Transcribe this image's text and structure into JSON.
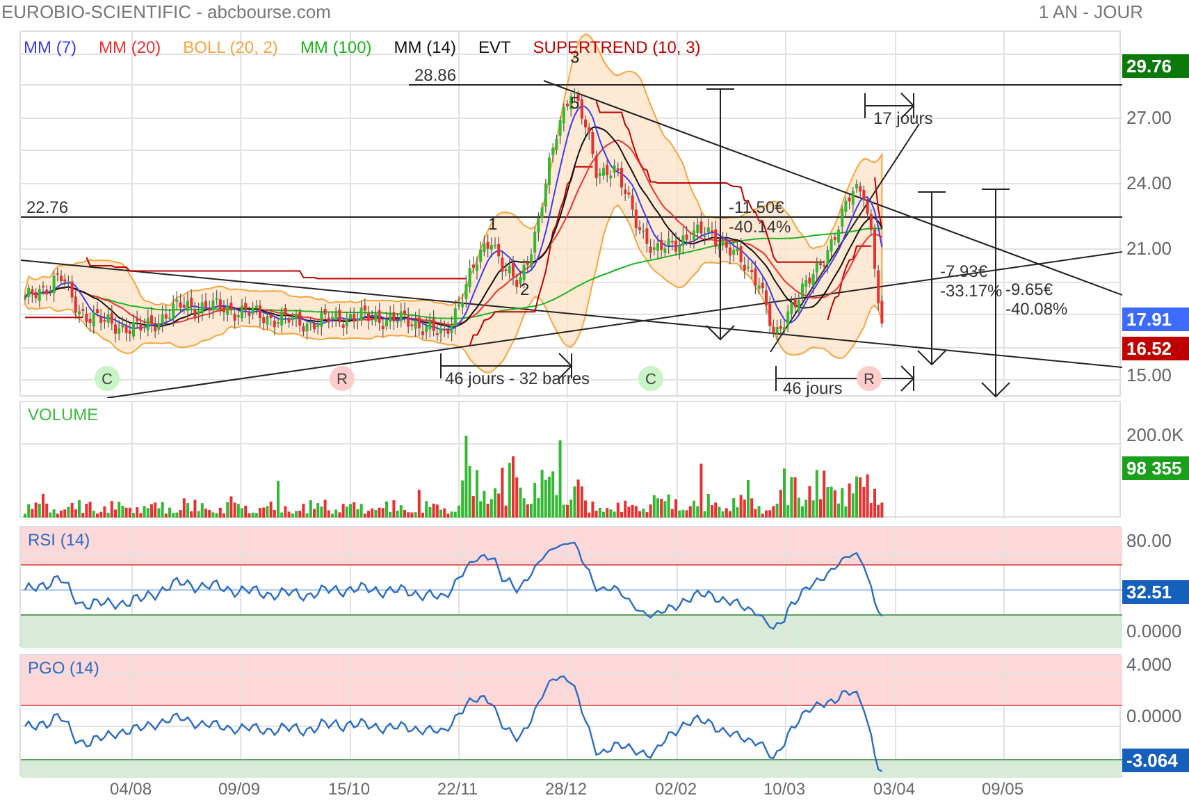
{
  "header": {
    "title": "EUROBIO-SCIENTIFIC - abcbourse.com",
    "period": "1 AN - JOUR"
  },
  "legend": [
    {
      "label": "MM (7)",
      "color": "#3b3bf5"
    },
    {
      "label": "MM (20)",
      "color": "#f03030"
    },
    {
      "label": "BOLL (20, 2)",
      "color": "#f5a53c"
    },
    {
      "label": "MM (100)",
      "color": "#1cb41c"
    },
    {
      "label": "MM (14)",
      "color": "#111111"
    },
    {
      "label": "EVT",
      "color": "#111111"
    },
    {
      "label": "SUPERTREND (10, 3)",
      "color": "#c00000"
    }
  ],
  "price_panel": {
    "levels": [
      "28.86",
      "22.76"
    ],
    "waves": [
      "1",
      "2",
      "3",
      "5"
    ],
    "measures": [
      {
        "amount": "-11.50€",
        "percent": "-40.14%"
      },
      {
        "amount": "-7.93€",
        "percent": "-33.17%"
      },
      {
        "amount": "-9.65€",
        "percent": "-40.08%"
      }
    ],
    "durations": [
      "46 jours - 32 barres",
      "46 jours",
      "17 jours"
    ],
    "events": [
      {
        "letter": "C",
        "color": "#c8f4c8"
      },
      {
        "letter": "R",
        "color": "#ffcccc"
      },
      {
        "letter": "C",
        "color": "#c8f4c8"
      },
      {
        "letter": "R",
        "color": "#ffcccc"
      }
    ],
    "axis": {
      "ticks": [
        "27.00",
        "24.00",
        "21.00",
        "15.00"
      ],
      "markers": [
        {
          "value": "29.76",
          "color": "#0b7a0b"
        },
        {
          "value": "17.91",
          "color": "#3d6bff"
        },
        {
          "value": "16.52",
          "color": "#c00000"
        }
      ]
    }
  },
  "volume_panel": {
    "title": "VOLUME",
    "axis": {
      "ticks": [
        "200.0K"
      ],
      "markers": [
        {
          "value": "98 355",
          "color": "#1aa01a"
        }
      ]
    }
  },
  "rsi_panel": {
    "title": "RSI (14)",
    "axis": {
      "ticks": [
        "80.00",
        "0.0000"
      ],
      "markers": [
        {
          "value": "32.51",
          "color": "#1560bd"
        }
      ]
    }
  },
  "pgo_panel": {
    "title": "PGO (14)",
    "axis": {
      "ticks": [
        "4.000",
        "0.0000"
      ],
      "markers": [
        {
          "value": "-3.064",
          "color": "#1560bd"
        }
      ]
    }
  },
  "x_axis": [
    "04/08",
    "09/09",
    "15/10",
    "22/11",
    "28/12",
    "02/02",
    "10/03",
    "03/04",
    "09/05"
  ]
}
